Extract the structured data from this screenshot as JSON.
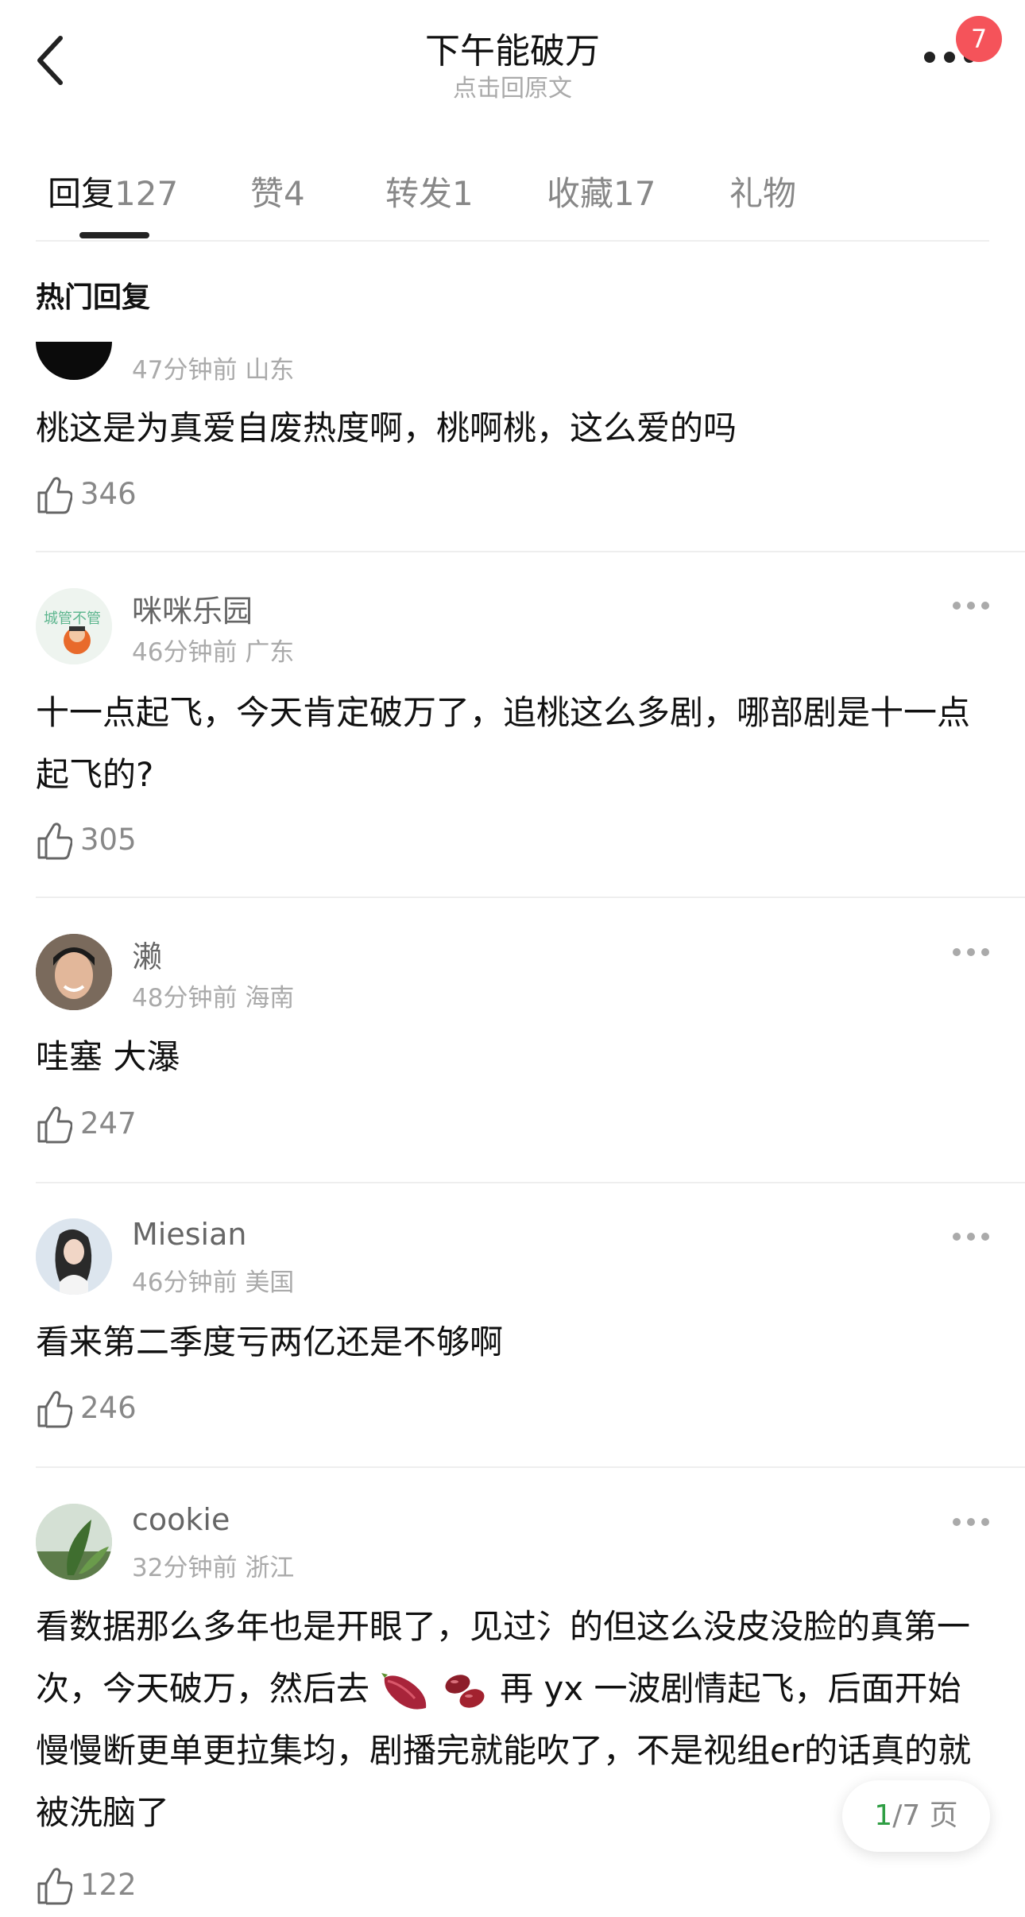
{
  "header": {
    "title": "下午能破万",
    "subtitle": "点击回原文",
    "badge": "7"
  },
  "tabs": [
    {
      "label": "回复",
      "count": "127",
      "active": true
    },
    {
      "label": "赞",
      "count": "4"
    },
    {
      "label": "转发",
      "count": "1"
    },
    {
      "label": "收藏",
      "count": "17"
    },
    {
      "label": "礼物",
      "count": ""
    }
  ],
  "section_title": "热门回复",
  "comments": [
    {
      "name": "",
      "time": "47分钟前",
      "location": "山东",
      "text": "桃这是为真爱自废热度啊，桃啊桃，这么爱的吗",
      "likes": "346"
    },
    {
      "name": "咪咪乐园",
      "time": "46分钟前",
      "location": "广东",
      "text": "十一点起飞，今天肯定破万了，追桃这么多剧，哪部剧是十一点起飞的?",
      "likes": "305"
    },
    {
      "name": "濑",
      "time": "48分钟前",
      "location": "海南",
      "text": "哇塞 大瀑",
      "likes": "247"
    },
    {
      "name": "Miesian",
      "time": "46分钟前",
      "location": "美国",
      "text": "看来第二季度亏两亿还是不够啊",
      "likes": "246"
    },
    {
      "name": "cookie",
      "time": "32分钟前",
      "location": "浙江",
      "text_parts": [
        "看数据那么多年也是开眼了，见过氵的但这么没皮没脸的真第一次，今天破万，然后去",
        "再 yx 一波剧情起飞，后面开始慢慢断更单更拉集均，剧播完就能吹了，不是视组er的话真的就被洗脑了"
      ],
      "likes": "122"
    }
  ],
  "pager": {
    "current": "1",
    "total": "/7 页"
  }
}
